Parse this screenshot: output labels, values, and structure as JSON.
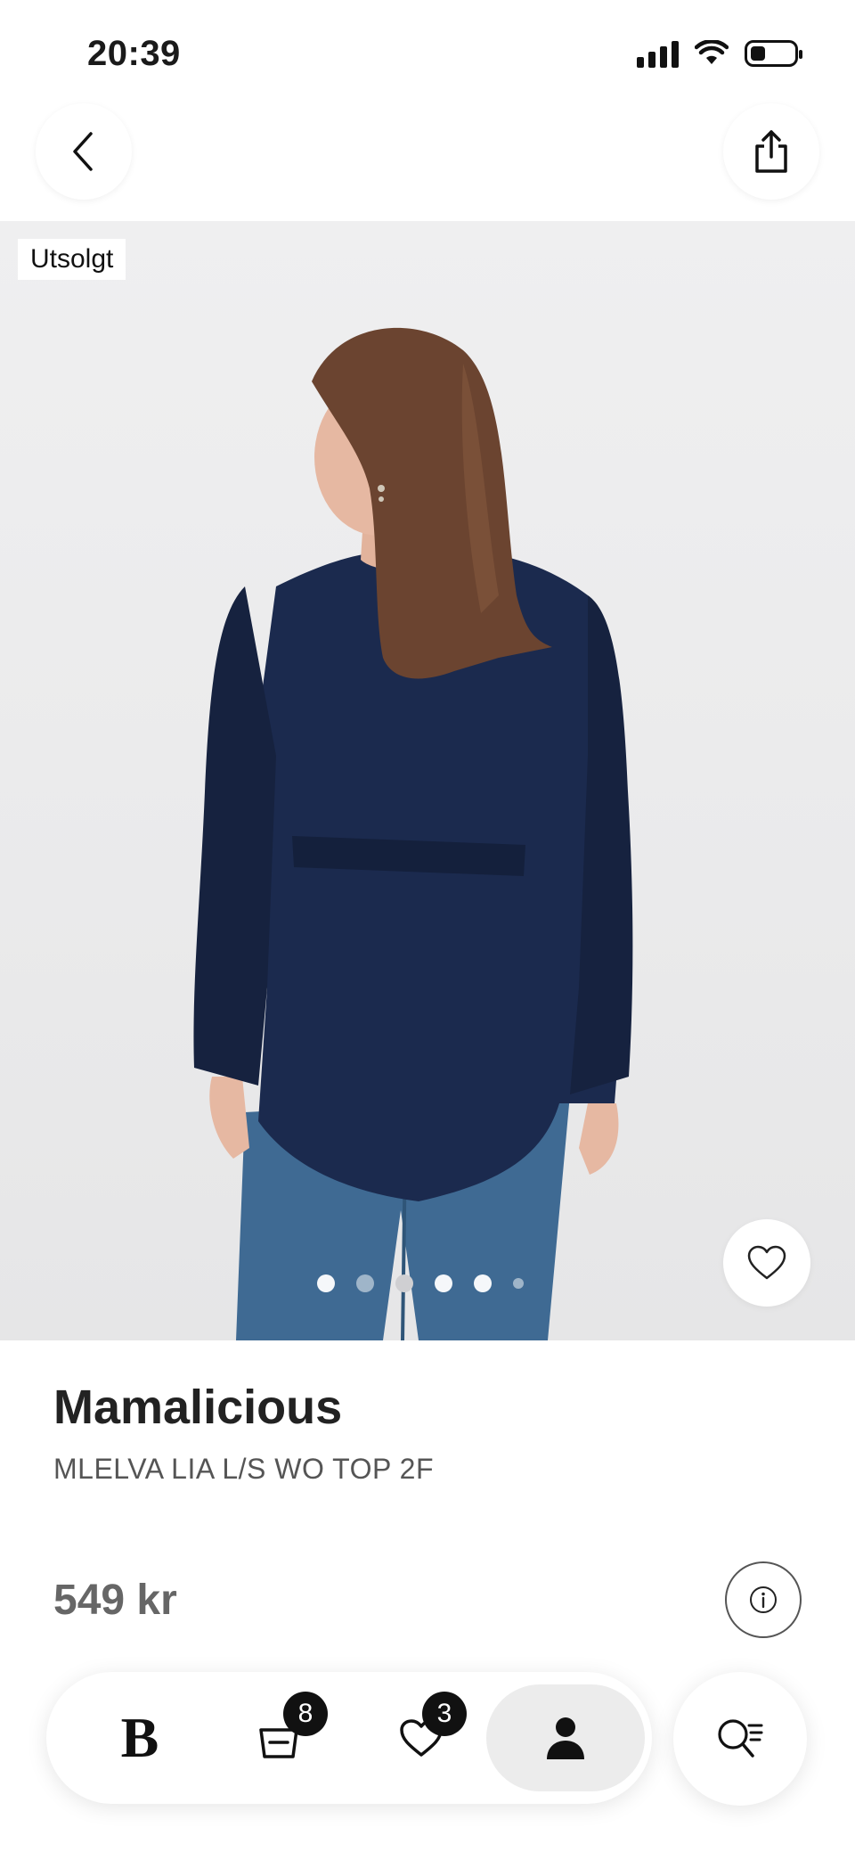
{
  "status_bar": {
    "time": "20:39"
  },
  "header": {
    "back_icon": "chevron-left-icon",
    "share_icon": "share-icon"
  },
  "product_image": {
    "badge": "Utsolgt",
    "favorite_icon": "heart-icon",
    "carousel": {
      "total": 6,
      "active_index": 1
    }
  },
  "product": {
    "brand": "Mamalicious",
    "name": "MLELVA LIA L/S WO TOP 2F",
    "price": "549 kr",
    "info_icon": "info-icon"
  },
  "tab_bar": {
    "home_logo": "B",
    "bag_count": "8",
    "wishlist_count": "3",
    "profile_icon": "person-icon",
    "search_icon": "search-filter-icon"
  }
}
